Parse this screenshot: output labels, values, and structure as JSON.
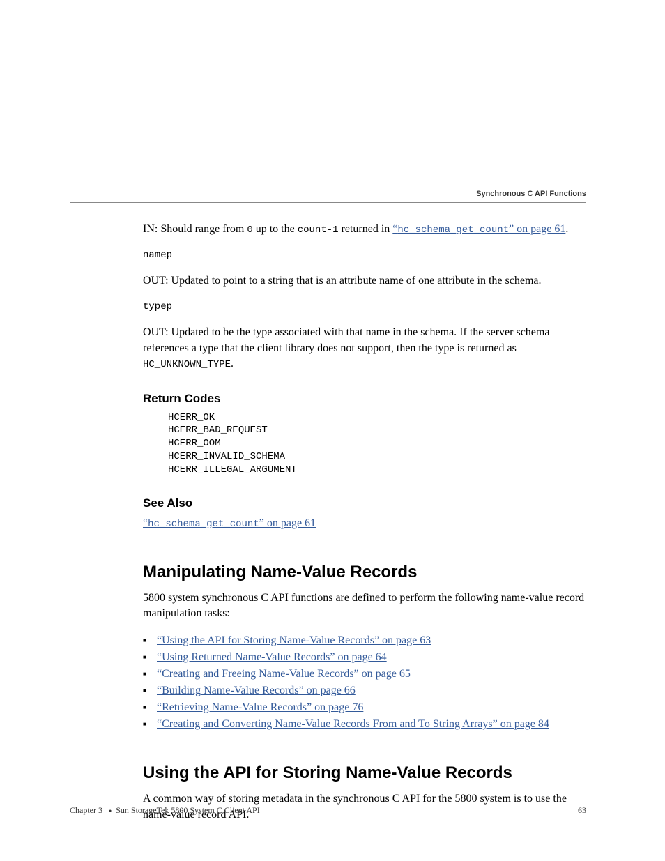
{
  "running_head": "Synchronous C API Functions",
  "p_in": {
    "prefix": "IN: Should range from ",
    "zero": "0",
    "mid": " up to the ",
    "countexpr": "count-1",
    "after": " returned in ",
    "linkq1": "“",
    "linkcode": "hc_schema_get_count",
    "linkq2": "” on page 61",
    "tail": "."
  },
  "namep": "namep",
  "p_out1": "OUT: Updated to point to a string that is an attribute name of one attribute in the schema.",
  "typep": "typep",
  "p_out2a": "OUT: Updated to be the type associated with that name in the schema. If the server schema references a type that the client library does not support, then the type is returned as ",
  "p_out2b": "HC_UNKNOWN_TYPE",
  "p_out2c": ".",
  "h_return": "Return Codes",
  "codes": "HCERR_OK\nHCERR_BAD_REQUEST\nHCERR_OOM\nHCERR_INVALID_SCHEMA\nHCERR_ILLEGAL_ARGUMENT",
  "h_seealso": "See Also",
  "seealso": {
    "q1": "“",
    "code": "hc_schema_get_count",
    "q2": "” on page 61"
  },
  "h_manip": "Manipulating Name-Value Records",
  "p_manip": "5800 system synchronous C API functions are defined to perform the following name-value record manipulation tasks:",
  "bullets": [
    "“Using the API for Storing Name-Value Records” on page 63",
    "“Using Returned Name-Value Records” on page 64",
    "“Creating and Freeing Name-Value Records” on page 65",
    "“Building Name-Value Records” on page 66",
    "“Retrieving Name-Value Records” on page 76",
    "“Creating and Converting Name-Value Records From and To String Arrays” on page 84"
  ],
  "h_using": "Using the API for Storing Name-Value Records",
  "p_using": "A common way of storing metadata in the synchronous C API for the 5800 system is to use the name-value record API.",
  "footer": {
    "left_a": "Chapter 3 ",
    "left_b": "Sun StorageTek 5800 System C Client API",
    "right": "63"
  }
}
